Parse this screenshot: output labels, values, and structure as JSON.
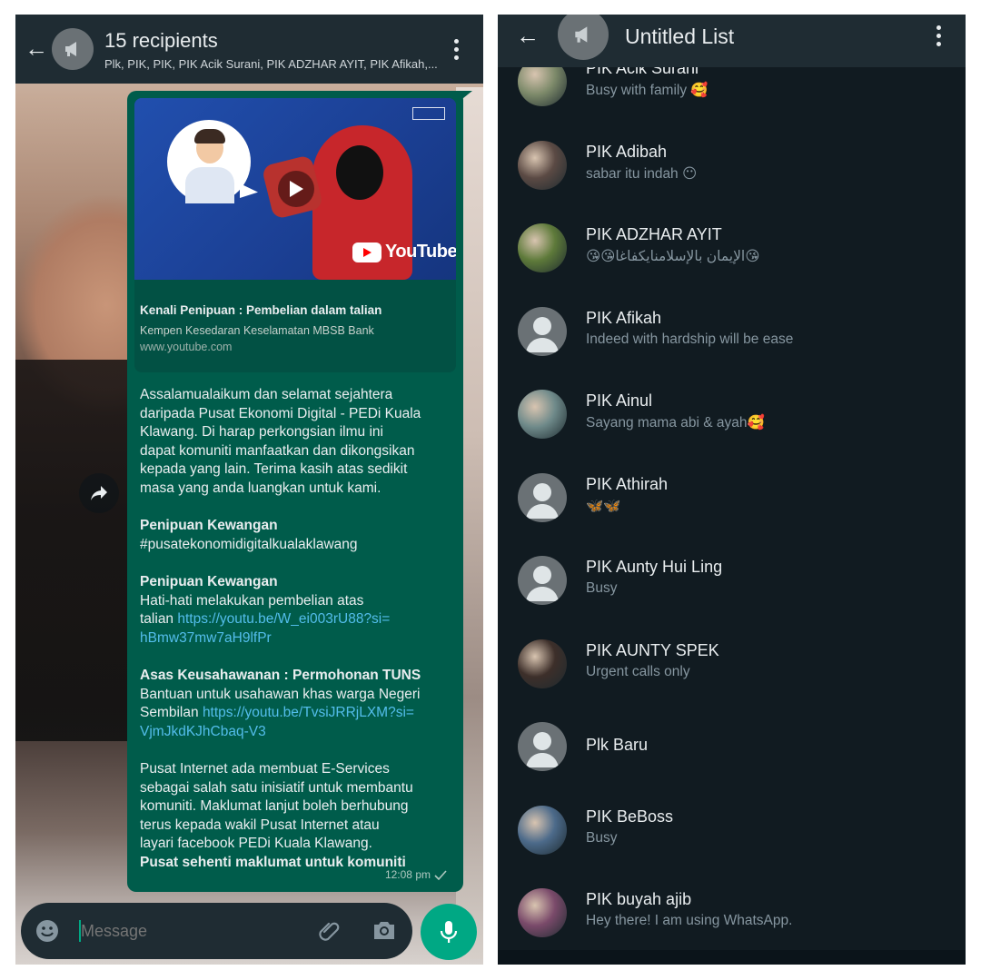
{
  "left_screen": {
    "header": {
      "title": "15 recipients",
      "subtitle": "Plk, PIK, PIK, PIK Acik Surani, PIK ADZHAR AYIT, PIK Afikah,..."
    },
    "link_preview": {
      "title": "Kenali Penipuan : Pembelian dalam talian",
      "description": "Kempen Kesedaran Keselamatan MBSB Bank",
      "url": "www.youtube.com",
      "thumbnail_brand": "YouTube"
    },
    "message": {
      "intro_lines": [
        "Assalamualaikum dan selamat sejahtera",
        "daripada Pusat Ekonomi Digital - PEDi Kuala",
        "Klawang. Di harap perkongsian ilmu ini",
        "dapat komuniti manfaatkan dan dikongsikan",
        "kepada yang lain. Terima kasih atas sedikit",
        "masa yang anda luangkan untuk kami."
      ],
      "section1_title": "Penipuan Kewangan",
      "section1_hashtag": "#pusatekonomidigitalkualaklawang",
      "section2_title": "Penipuan Kewangan",
      "section2_line1": "Hati-hati melakukan pembelian atas",
      "section2_line2_prefix": "talian ",
      "section2_link_a": "https://youtu.be/W_ei003rU88?si=",
      "section2_link_b": "hBmw37mw7aH9lfPr",
      "section3_title": "Asas Keusahawanan : Permohonan TUNS",
      "section3_line1": "Bantuan untuk usahawan khas warga Negeri",
      "section3_line2_prefix": "Sembilan  ",
      "section3_link_a": "https://youtu.be/TvsiJRRjLXM?si=",
      "section3_link_b": "VjmJkdKJhCbaq-V3",
      "closing_lines": [
        "Pusat Internet ada membuat E-Services",
        "sebagai salah satu inisiatif untuk membantu",
        "komuniti.  Maklumat lanjut boleh berhubung",
        "terus kepada wakil Pusat Internet atau",
        "layari facebook PEDi Kuala Klawang."
      ],
      "closing_bold": "Pusat sehenti maklumat untuk komuniti",
      "time": "12:08 pm",
      "status_icon": "single-check-icon"
    },
    "input": {
      "placeholder": "Message"
    }
  },
  "right_screen": {
    "header": {
      "title": "Untitled List"
    },
    "contacts": [
      {
        "name": "PIK Acik Surani",
        "status": "Busy with family 🥰",
        "avatar": "photo",
        "color": "#7d8a6a"
      },
      {
        "name": "PIK Adibah",
        "status": "sabar itu indah 😶",
        "avatar": "photo",
        "color": "#5b4a44"
      },
      {
        "name": "PIK ADZHAR AYIT",
        "status": "😘😘الإيمان بالإسلامنايكفاغا😘",
        "avatar": "photo",
        "color": "#5e7a3a"
      },
      {
        "name": "PIK Afikah",
        "status": "Indeed with hardship will be ease",
        "avatar": "default",
        "color": "#6a7175"
      },
      {
        "name": "PIK Ainul",
        "status": "Sayang mama abi & ayah🥰",
        "avatar": "photo",
        "color": "#6f8a8a"
      },
      {
        "name": "PIK Athirah",
        "status": "🦋🦋",
        "avatar": "default",
        "color": "#6a7175"
      },
      {
        "name": "PIK Aunty Hui Ling",
        "status": "Busy",
        "avatar": "default",
        "color": "#6a7175"
      },
      {
        "name": "PIK AUNTY SPEK",
        "status": "Urgent calls only",
        "avatar": "photo",
        "color": "#3d2f2a"
      },
      {
        "name": "Plk Baru",
        "status": "",
        "avatar": "default",
        "color": "#6a7175"
      },
      {
        "name": "PIK BeBoss",
        "status": "Busy",
        "avatar": "photo",
        "color": "#4c6a8a"
      },
      {
        "name": "PIK buyah ajib",
        "status": "Hey there! I am using WhatsApp.",
        "avatar": "photo",
        "color": "#7a4a6a"
      }
    ]
  },
  "colors": {
    "header_bg": "#1f2c33",
    "chat_bg": "#111b21",
    "bubble_green": "#005c4b",
    "accent": "#00a884",
    "link": "#53bdeb"
  }
}
